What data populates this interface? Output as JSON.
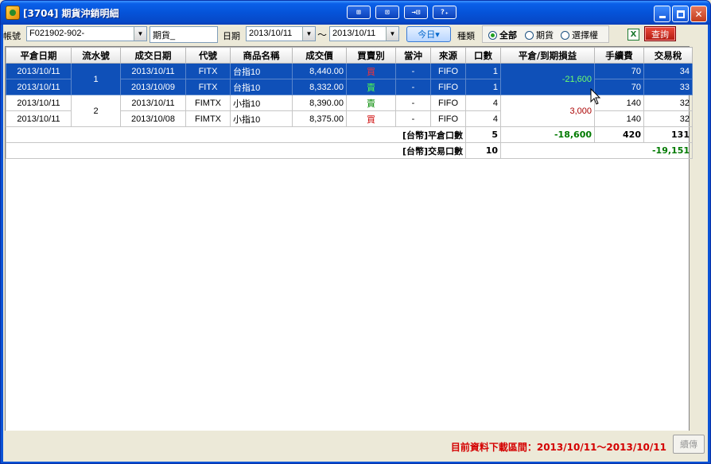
{
  "window": {
    "title": "[3704] 期貨沖銷明細",
    "toolbar_buttons": [
      "⊞",
      "⊡",
      "→⊡",
      "?₊"
    ]
  },
  "filters": {
    "account_label": "帳號",
    "account_value": "F021902-902-",
    "account_name": "期貨_",
    "date_label": "日期",
    "date_from": "2013/10/11",
    "date_sep": "～",
    "date_to": "2013/10/11",
    "today_button": "今日▾",
    "type_label": "種類",
    "type_options": [
      "全部",
      "期貨",
      "選擇權"
    ],
    "excel_icon": "X",
    "query_button": "查詢"
  },
  "table": {
    "headers": [
      "平倉日期",
      "流水號",
      "成交日期",
      "代號",
      "商品名稱",
      "成交價",
      "買賣別",
      "當沖",
      "來源",
      "口數",
      "平倉/到期損益",
      "手續費",
      "交易稅"
    ],
    "rows": [
      {
        "close_date": "2013/10/11",
        "seq": "1",
        "trade_date": "2013/10/11",
        "code": "FITX",
        "name": "台指10",
        "price": "8,440.00",
        "side": "買",
        "daytrade": "-",
        "source": "FIFO",
        "qty": "1",
        "pl": "-21,600",
        "fee": "70",
        "tax": "34"
      },
      {
        "close_date": "2013/10/11",
        "seq": "",
        "trade_date": "2013/10/09",
        "code": "FITX",
        "name": "台指10",
        "price": "8,332.00",
        "side": "賣",
        "daytrade": "-",
        "source": "FIFO",
        "qty": "1",
        "pl": "",
        "fee": "70",
        "tax": "33"
      },
      {
        "close_date": "2013/10/11",
        "seq": "2",
        "trade_date": "2013/10/11",
        "code": "FIMTX",
        "name": "小指10",
        "price": "8,390.00",
        "side": "賣",
        "daytrade": "-",
        "source": "FIFO",
        "qty": "4",
        "pl": "3,000",
        "fee": "140",
        "tax": "32"
      },
      {
        "close_date": "2013/10/11",
        "seq": "",
        "trade_date": "2013/10/08",
        "code": "FIMTX",
        "name": "小指10",
        "price": "8,375.00",
        "side": "買",
        "daytrade": "-",
        "source": "FIFO",
        "qty": "4",
        "pl": "",
        "fee": "140",
        "tax": "32"
      }
    ],
    "total_close": {
      "label": "[台幣]平倉口數",
      "qty": "5",
      "pl": "-18,600",
      "fee": "420",
      "tax": "131"
    },
    "total_trade": {
      "label": "[台幣]交易口數",
      "qty": "10",
      "net": "-19,151"
    }
  },
  "status": {
    "range_text": "目前資料下載區間：2013/10/11～2013/10/11",
    "continue_button": "續傳"
  }
}
